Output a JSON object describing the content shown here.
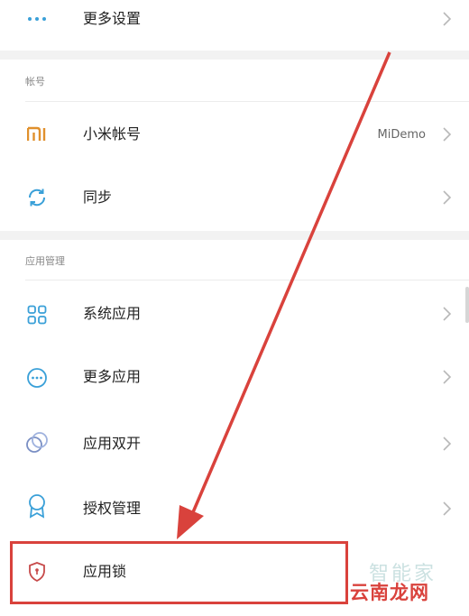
{
  "colors": {
    "accent_blue": "#3aa0d8",
    "mi_orange": "#e0902c",
    "lock_red": "#c74a4a",
    "highlight_red": "#d9423c"
  },
  "rows": {
    "more_settings": {
      "label": "更多设置",
      "icon": "more-dots-icon"
    },
    "mi_account": {
      "label": "小米帐号",
      "value": "MiDemo",
      "icon": "mi-logo-icon"
    },
    "sync": {
      "label": "同步",
      "icon": "sync-icon"
    },
    "system_apps": {
      "label": "系统应用",
      "icon": "grid-icon"
    },
    "more_apps": {
      "label": "更多应用",
      "icon": "more-circle-icon"
    },
    "dual_apps": {
      "label": "应用双开",
      "icon": "dual-circle-icon"
    },
    "permissions": {
      "label": "授权管理",
      "icon": "badge-icon"
    },
    "app_lock": {
      "label": "应用锁",
      "icon": "shield-lock-icon"
    }
  },
  "sections": {
    "account": "帐号",
    "app_management": "应用管理"
  },
  "watermark": {
    "line1": "智能家",
    "line2": "云南龙网"
  }
}
